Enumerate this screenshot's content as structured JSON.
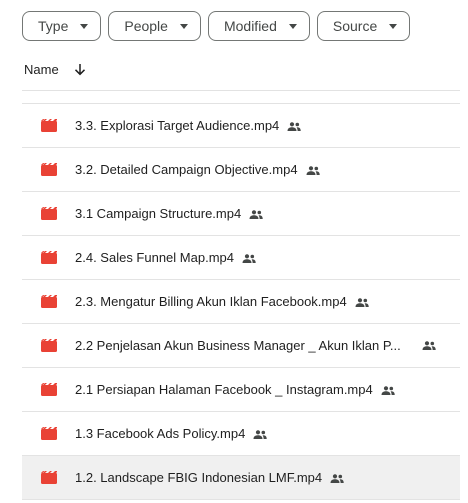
{
  "filters": [
    {
      "label": "Type"
    },
    {
      "label": "People"
    },
    {
      "label": "Modified"
    },
    {
      "label": "Source"
    }
  ],
  "header": {
    "name_label": "Name",
    "sort": "descending"
  },
  "files": [
    {
      "name": "3.3. Explorasi Target Audience.mp4",
      "shared": true
    },
    {
      "name": "3.2. Detailed Campaign Objective.mp4",
      "shared": true
    },
    {
      "name": "3.1 Campaign Structure.mp4",
      "shared": true
    },
    {
      "name": "2.4. Sales Funnel Map.mp4",
      "shared": true
    },
    {
      "name": "2.3. Mengatur Billing Akun Iklan Facebook.mp4",
      "shared": true
    },
    {
      "name": "2.2 Penjelasan Akun Business Manager _ Akun Iklan P...",
      "shared": true
    },
    {
      "name": "2.1 Persiapan Halaman Facebook _ Instagram.mp4",
      "shared": true
    },
    {
      "name": "1.3 Facebook Ads Policy.mp4",
      "shared": true
    },
    {
      "name": "1.2. Landscape FBIG Indonesian LMF.mp4",
      "shared": true
    }
  ],
  "colors": {
    "video_icon": "#e94235",
    "selected_row": "#f0f0f0"
  },
  "icons": {
    "file": "video-file-icon",
    "shared": "shared-people-icon",
    "sort": "arrow-down-icon",
    "chip": "dropdown-caret-icon"
  }
}
